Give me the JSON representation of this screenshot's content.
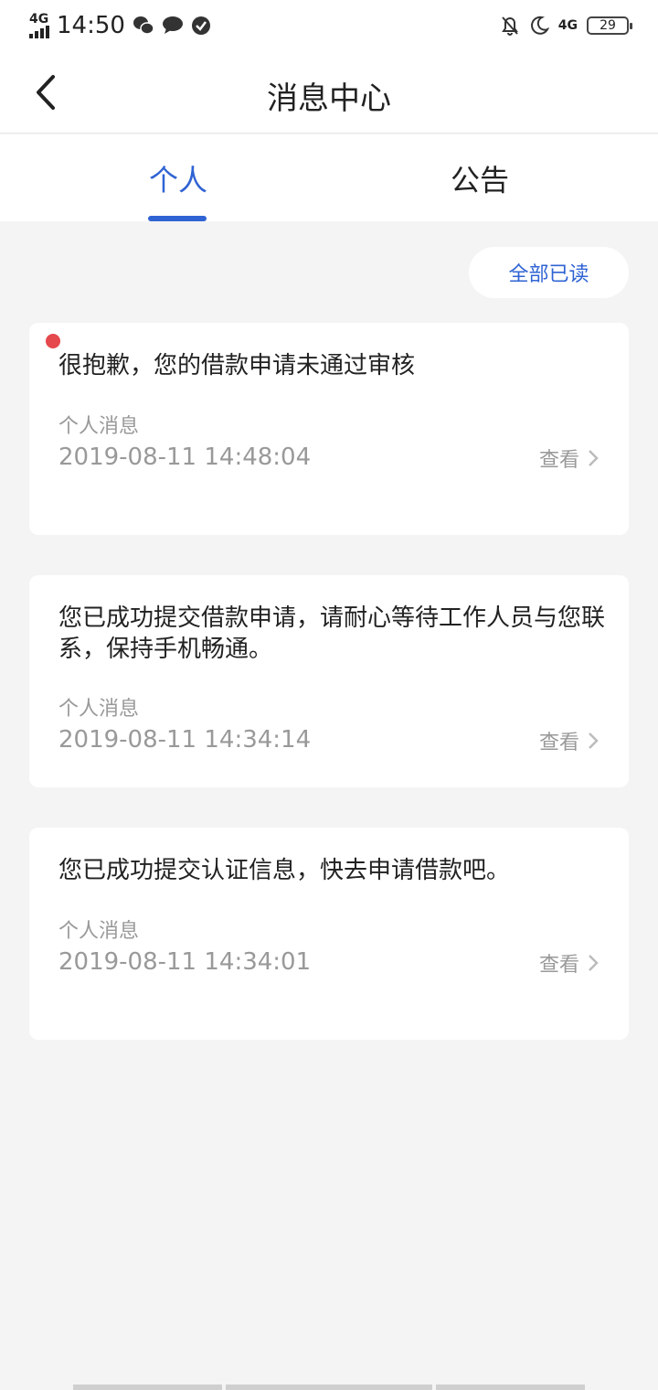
{
  "status_bar": {
    "network": "4G",
    "time": "14:50",
    "right_network": "4G",
    "battery": "29"
  },
  "nav": {
    "title": "消息中心"
  },
  "tabs": [
    {
      "label": "个人",
      "active": true
    },
    {
      "label": "公告",
      "active": false
    }
  ],
  "mark_all_read": "全部已读",
  "messages": [
    {
      "title": "很抱歉，您的借款申请未通过审核",
      "category": "个人消息",
      "time": "2019-08-11 14:48:04",
      "view": "查看",
      "unread": true
    },
    {
      "title": "您已成功提交借款申请，请耐心等待工作人员与您联系，保持手机畅通。",
      "category": "个人消息",
      "time": "2019-08-11 14:34:14",
      "view": "查看",
      "unread": false
    },
    {
      "title": "您已成功提交认证信息，快去申请借款吧。",
      "category": "个人消息",
      "time": "2019-08-11 14:34:01",
      "view": "查看",
      "unread": false
    }
  ],
  "colors": {
    "accent": "#2f63d3",
    "unread_dot": "#e5484d",
    "background": "#f4f4f5"
  }
}
